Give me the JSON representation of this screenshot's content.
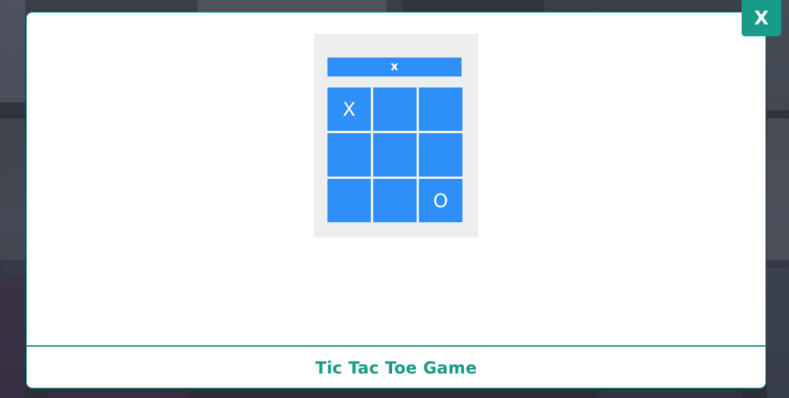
{
  "modal": {
    "close_label": "X",
    "title": "Tic Tac Toe Game"
  },
  "game": {
    "status": "x",
    "cells": [
      "X",
      "",
      "",
      "",
      "",
      "",
      "",
      "",
      "O"
    ]
  },
  "colors": {
    "accent": "#1a9a88",
    "board_blue": "#2e8ff8",
    "preview_bg": "#eeeeee"
  }
}
